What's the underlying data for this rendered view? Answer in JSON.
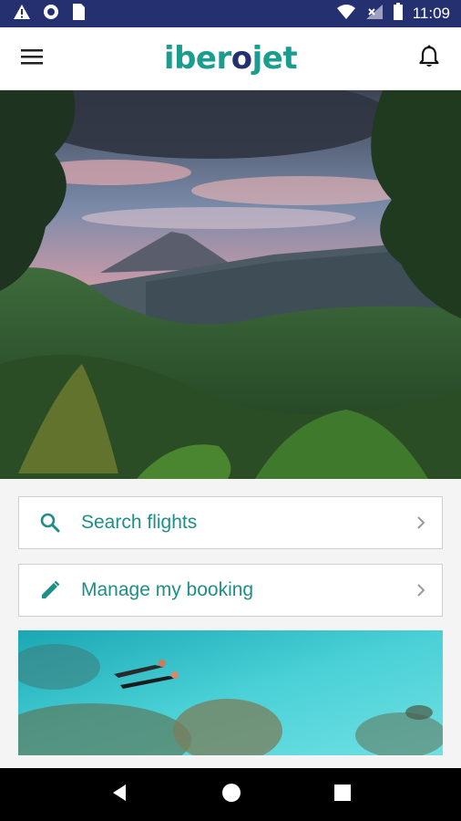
{
  "status_bar": {
    "time": "11:09",
    "icons": [
      "warning-icon",
      "sync-circle-icon",
      "sim-card-icon",
      "wifi-icon",
      "signal-icon",
      "battery-icon"
    ]
  },
  "app_bar": {
    "logo_text_main": "iber",
    "logo_text_dot": "o",
    "logo_text_end": "jet",
    "menu_icon": "hamburger-menu-icon",
    "notification_icon": "bell-icon"
  },
  "hero": {
    "image": "rainforest-volcano-landscape"
  },
  "actions": [
    {
      "label": "Search flights",
      "icon": "search-icon"
    },
    {
      "label": "Manage my booking",
      "icon": "pencil-icon"
    }
  ],
  "promo": {
    "image": "snorkelers-turquoise-sea"
  },
  "colors": {
    "status_bar": "#24306f",
    "brand_teal": "#1a9c8f",
    "brand_navy": "#24306f",
    "label_teal": "#1e8f84"
  }
}
